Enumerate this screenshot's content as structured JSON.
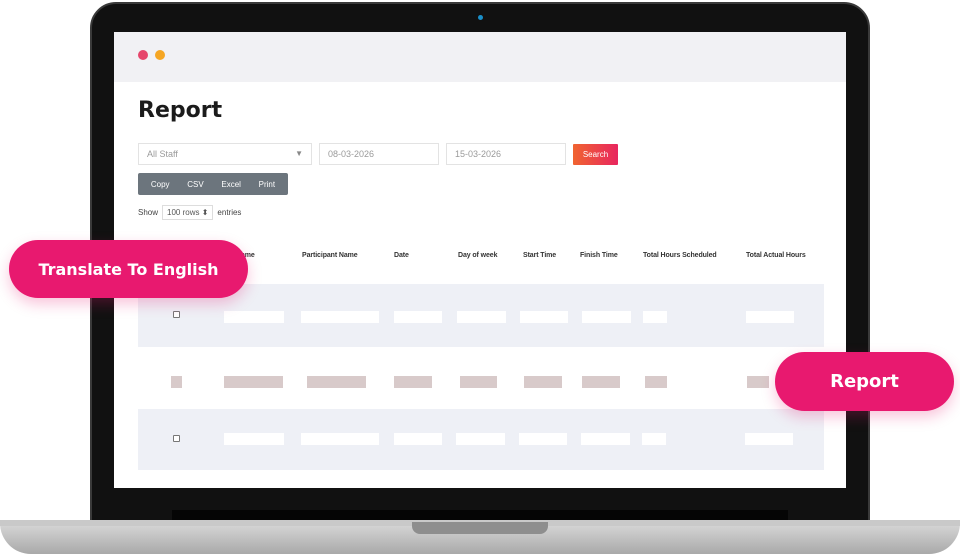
{
  "app": {
    "title": "Report"
  },
  "filters": {
    "staff_select": "All Staff",
    "date_from": "08-03-2026",
    "date_to": "15-03-2026",
    "search_label": "Search"
  },
  "export_buttons": [
    "Copy",
    "CSV",
    "Excel",
    "Print"
  ],
  "length_menu": {
    "prefix": "Show",
    "value": "100 rows",
    "suffix": "entries"
  },
  "table": {
    "columns": [
      "Name",
      "Participant Name",
      "Date",
      "Day of week",
      "Start Time",
      "Finish Time",
      "Total Hours Scheduled",
      "Total Actual Hours"
    ]
  },
  "overlays": {
    "translate_label": "Translate To English",
    "report_label": "Report"
  },
  "colors": {
    "accent_pink": "#e8196f",
    "search_gradient_start": "#f06430",
    "search_gradient_end": "#e8265f",
    "export_group_bg": "#6c757d",
    "row_stripe": "#eef0f6",
    "placeholder_bar": "#d8caca"
  },
  "icons": {
    "window_dot_close": "red-dot-icon",
    "window_dot_minimize": "orange-dot-icon",
    "select_caret": "chevron-down-icon",
    "camera": "camera-icon"
  }
}
